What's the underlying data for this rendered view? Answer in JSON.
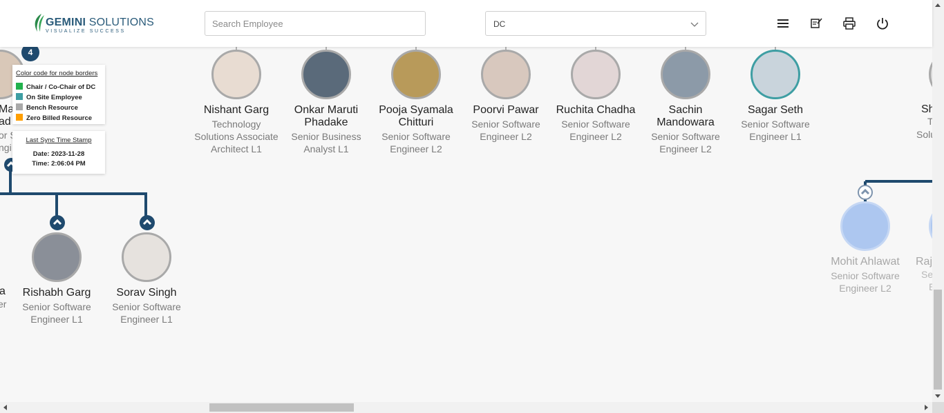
{
  "header": {
    "logo_main": "GEMINI",
    "logo_sub": "SOLUTIONS",
    "logo_tagline": "VISUALIZE SUCCESS",
    "search_placeholder": "Search Employee",
    "dropdown_value": "DC"
  },
  "header_icons": [
    "menu-icon",
    "notes-icon",
    "print-icon",
    "power-icon"
  ],
  "legend": {
    "title": "Color code for node borders",
    "items": [
      {
        "label": "Chair / Co-Chair of DC",
        "color": "#22b14c"
      },
      {
        "label": "On Site Employee",
        "color": "#3e9ea3"
      },
      {
        "label": "Bench Resource",
        "color": "#a9a9a9"
      },
      {
        "label": "Zero Billed Resource",
        "color": "#ff9f00"
      }
    ]
  },
  "sync": {
    "title": "Last Sync Time Stamp",
    "date": "Date: 2023-11-28",
    "time": "Time: 2:06:04 PM"
  },
  "count_badge": "4",
  "top_row": [
    {
      "name": "Nishant Garg",
      "role": "Technology Solutions Associate Architect L1"
    },
    {
      "name": "Onkar Maruti Phadake",
      "role": "Senior Business Analyst L1"
    },
    {
      "name": "Pooja Syamala Chitturi",
      "role": "Senior Software Engineer L2"
    },
    {
      "name": "Poorvi Pawar",
      "role": "Senior Software Engineer L2"
    },
    {
      "name": "Ruchita Chadha",
      "role": "Senior Software Engineer L2"
    },
    {
      "name": "Sachin Mandowara",
      "role": "Senior Software Engineer L2"
    },
    {
      "name": "Sagar Seth",
      "role": "Senior Software Engineer L1"
    }
  ],
  "bottom_row": [
    {
      "name": "Rishabh Garg",
      "role": "Senior Software Engineer L1"
    },
    {
      "name": "Sorav Singh",
      "role": "Senior Software Engineer L1"
    }
  ],
  "faded_node": {
    "name": "Mohit Ahlawat",
    "role": "Senior Software Engineer L2"
  },
  "partials": {
    "left_top_name_1": "Mar",
    "left_top_name_2": "ad",
    "left_top_role_1": "or S",
    "left_top_role_2": "ngi",
    "left_bottom_name": "a",
    "left_bottom_role": "er",
    "right_top_name": "Sh",
    "right_top_role_1": "T",
    "right_top_role_2": "Solu",
    "right_faded_name": "Raj",
    "right_faded_role_1": "Se",
    "right_faded_role_2": "E"
  }
}
